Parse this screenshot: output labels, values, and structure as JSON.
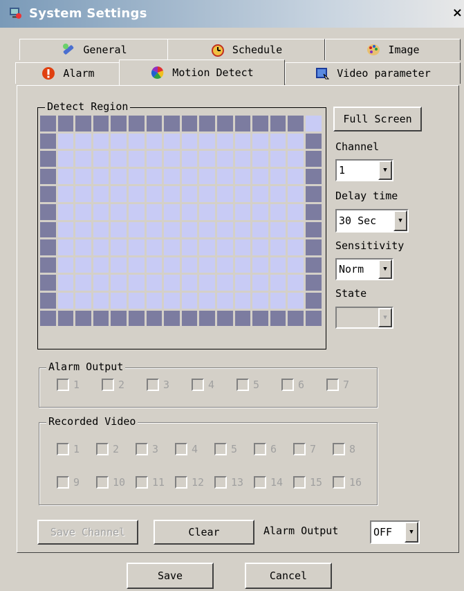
{
  "window": {
    "title": "System Settings",
    "close": "×"
  },
  "tabs": {
    "general": "General",
    "schedule": "Schedule",
    "image": "Image",
    "alarm": "Alarm",
    "motion_detect": "Motion Detect",
    "video_parameter": "Video parameter"
  },
  "detect_region": {
    "label": "Detect Region",
    "rows": 12,
    "cols": 16
  },
  "right": {
    "full_screen": "Full Screen",
    "channel_label": "Channel",
    "channel_value": "1",
    "delay_label": "Delay time",
    "delay_value": "30 Sec",
    "sensitivity_label": "Sensitivity",
    "sensitivity_value": "Norm",
    "state_label": "State",
    "state_value": ""
  },
  "alarm_output_group": {
    "label": "Alarm Output",
    "items": [
      "1",
      "2",
      "3",
      "4",
      "5",
      "6",
      "7"
    ]
  },
  "recorded_video": {
    "label": "Recorded Video",
    "items": [
      "1",
      "2",
      "3",
      "4",
      "5",
      "6",
      "7",
      "8",
      "9",
      "10",
      "11",
      "12",
      "13",
      "14",
      "15",
      "16"
    ]
  },
  "bottom": {
    "save_channel": "Save Channel",
    "clear": "Clear",
    "alarm_output_label": "Alarm Output",
    "alarm_output_value": "OFF"
  },
  "footer": {
    "save": "Save",
    "cancel": "Cancel"
  },
  "colors": {
    "grid_on": "#c8cbf5",
    "grid_edge": "#7c7ca0",
    "face": "#d4d0c8"
  }
}
